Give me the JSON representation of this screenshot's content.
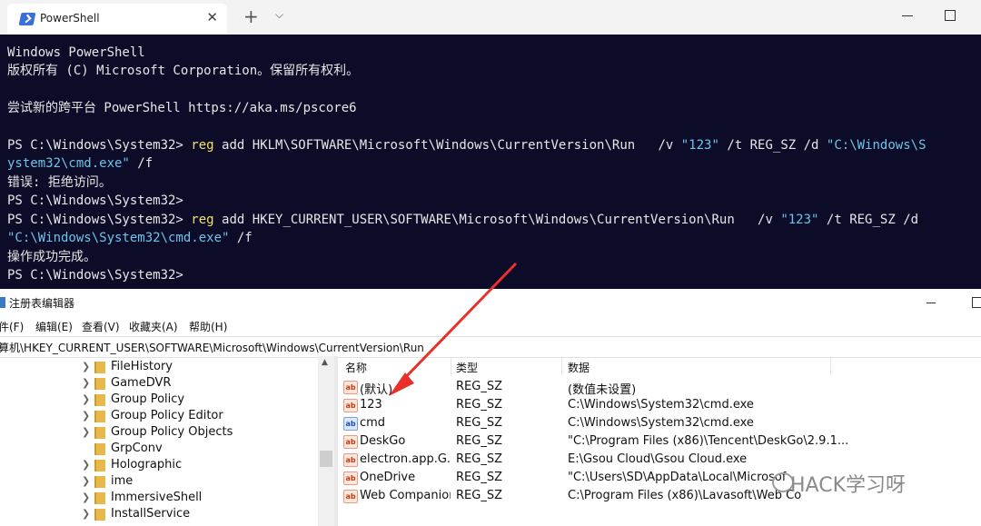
{
  "terminal": {
    "tab_title": "PowerShell",
    "tab_close": "✕",
    "new_tab": "+",
    "dropdown": "⌵",
    "lines": {
      "l0": "Windows PowerShell",
      "l1": "版权所有 (C) Microsoft Corporation。保留所有权利。",
      "l3": "尝试新的跨平台 PowerShell https://aka.ms/pscore6",
      "l5_prompt": "PS C:\\Windows\\System32> ",
      "l5_cmd": "reg",
      "l5_a": " add HKLM\\SOFTWARE\\Microsoft\\Windows\\CurrentVersion\\Run   /v ",
      "l5_v": "\"123\"",
      "l5_b": " /t REG_SZ /d ",
      "l5_d": "\"C:\\Windows\\S",
      "l6_d": "ystem32\\cmd.exe\"",
      "l6_rest": " /f",
      "l7": "错误: 拒绝访问。",
      "l8": "PS C:\\Windows\\System32>",
      "l9_prompt": "PS C:\\Windows\\System32> ",
      "l9_cmd": "reg",
      "l9_a": " add HKEY_CURRENT_USER\\SOFTWARE\\Microsoft\\Windows\\CurrentVersion\\Run   /v ",
      "l9_v": "\"123\"",
      "l9_b": " /t REG_SZ /d",
      "l10_d": "\"C:\\Windows\\System32\\cmd.exe\"",
      "l10_rest": " /f",
      "l11": "操作成功完成。",
      "l12": "PS C:\\Windows\\System32>"
    }
  },
  "regedit": {
    "title": "注册表编辑器",
    "menus": [
      "件(F)",
      "编辑(E)",
      "查看(V)",
      "收藏夹(A)",
      "帮助(H)"
    ],
    "address": "算机\\HKEY_CURRENT_USER\\SOFTWARE\\Microsoft\\Windows\\CurrentVersion\\Run",
    "tree": [
      "FileHistory",
      "GameDVR",
      "Group Policy",
      "Group Policy Editor",
      "Group Policy Objects",
      "GrpConv",
      "Holographic",
      "ime",
      "ImmersiveShell",
      "InstallService"
    ],
    "columns": {
      "name": "名称",
      "type": "类型",
      "data": "数据"
    },
    "values": [
      {
        "name": "(默认)",
        "type": "REG_SZ",
        "data": "(数值未设置)",
        "icon": "ab-icon"
      },
      {
        "name": "123",
        "type": "REG_SZ",
        "data": "C:\\Windows\\System32\\cmd.exe",
        "icon": "ab-icon"
      },
      {
        "name": "cmd",
        "type": "REG_SZ",
        "data": "C:\\Windows\\System32\\cmd.exe",
        "icon": "binary-icon"
      },
      {
        "name": "DeskGo",
        "type": "REG_SZ",
        "data": "\"C:\\Program Files (x86)\\Tencent\\DeskGo\\2.9.1...",
        "icon": "ab-icon"
      },
      {
        "name": "electron.app.G...",
        "type": "REG_SZ",
        "data": "E:\\Gsou Cloud\\Gsou Cloud.exe",
        "icon": "ab-icon"
      },
      {
        "name": "OneDrive",
        "type": "REG_SZ",
        "data": "\"C:\\Users\\SD\\AppData\\Local\\Microsof",
        "icon": "ab-icon"
      },
      {
        "name": "Web Companion",
        "type": "REG_SZ",
        "data": "C:\\Program Files (x86)\\Lavasoft\\Web Co",
        "icon": "ab-icon"
      }
    ]
  },
  "watermark": "HACK学习呀",
  "colors": {
    "terminal_bg": "#0c0c28",
    "keyword": "#f0e26a",
    "string": "#6fc3ea",
    "arrow": "#e8312a"
  }
}
